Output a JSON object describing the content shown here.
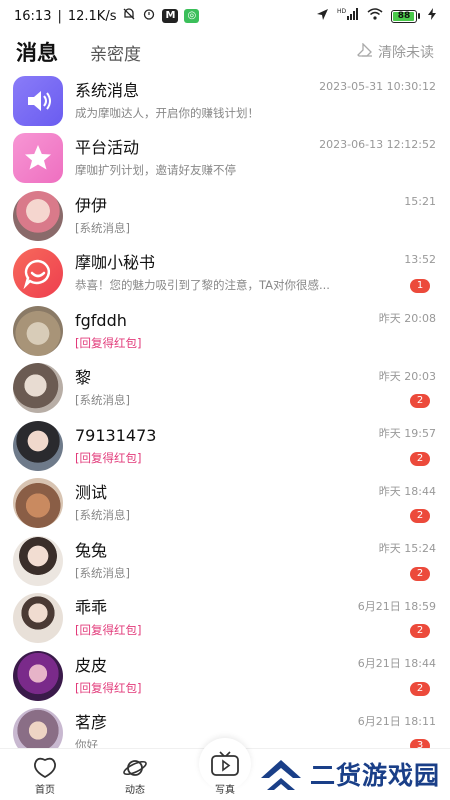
{
  "status_bar": {
    "time": "16:13",
    "speed": "12.1K/s",
    "badge_m": "M",
    "network": "HD",
    "battery": "88"
  },
  "header": {
    "tab_messages": "消息",
    "tab_intimacy": "亲密度",
    "clear_unread": "清除未读"
  },
  "messages": [
    {
      "name": "系统消息",
      "preview": "成为摩咖达人，开启你的赚钱计划！",
      "time": "2023-05-31 10:30:12",
      "count": "",
      "avatar": "speaker-icon"
    },
    {
      "name": "平台活动",
      "preview": "摩咖扩列计划，邀请好友赚不停",
      "time": "2023-06-13 12:12:52",
      "count": "",
      "avatar": "star-icon"
    },
    {
      "name": "伊伊",
      "preview": "[系统消息]",
      "time": "15:21",
      "count": ""
    },
    {
      "name": "摩咖小秘书",
      "preview": "恭喜！您的魅力吸引到了黎的注意，TA对你很感...",
      "time": "13:52",
      "count": "1",
      "avatar": "chat-smile-icon"
    },
    {
      "name": "fgfddh",
      "preview": "[回复得红包]",
      "time": "昨天 20:08",
      "count": ""
    },
    {
      "name": "黎",
      "preview": "[系统消息]",
      "time": "昨天 20:03",
      "count": "2"
    },
    {
      "name": "79131473",
      "preview": "[回复得红包]",
      "time": "昨天 19:57",
      "count": "2"
    },
    {
      "name": "测试",
      "preview": "[系统消息]",
      "time": "昨天 18:44",
      "count": "2"
    },
    {
      "name": "兔兔",
      "preview": "[系统消息]",
      "time": "昨天 15:24",
      "count": "2"
    },
    {
      "name": "乖乖",
      "preview": "[回复得红包]",
      "time": "6月21日 18:59",
      "count": "2"
    },
    {
      "name": "皮皮",
      "preview": "[回复得红包]",
      "time": "6月21日 18:44",
      "count": "2"
    },
    {
      "name": "茗彦",
      "preview": "你好",
      "time": "6月21日 18:11",
      "count": "3"
    }
  ],
  "bottom_nav": {
    "home": "首页",
    "feed": "动态",
    "photo": "写真"
  },
  "watermark": "二货游戏园",
  "colors": {
    "accent_red": "#ec4a3b",
    "hongbao_pink": "#e23a7a",
    "system_purple": "#7b6cf6",
    "activity_pink": "#f27cc4",
    "secretary_red": "#f2504a"
  }
}
